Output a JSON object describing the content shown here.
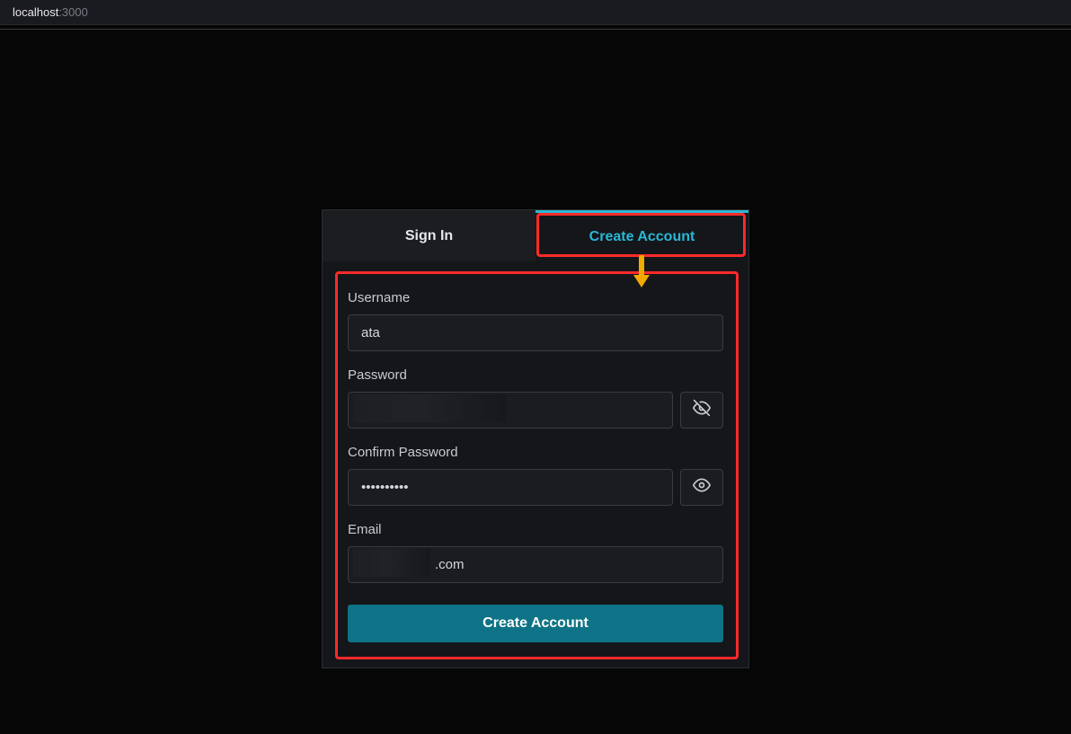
{
  "address": {
    "host": "localhost",
    "port": ":3000"
  },
  "tabs": {
    "signin_label": "Sign In",
    "create_label": "Create Account"
  },
  "form": {
    "username_label": "Username",
    "username_value": "ata",
    "password_label": "Password",
    "password_value": "",
    "confirm_label": "Confirm Password",
    "confirm_value": "••••••••••",
    "email_label": "Email",
    "email_value": ".com",
    "submit_label": "Create Account"
  },
  "icons": {
    "eye_hidden": "eye-off-icon",
    "eye_visible": "eye-icon"
  },
  "colors": {
    "accent": "#2ab7d6",
    "submit_bg": "#0e7386",
    "annotation": "#ff2a2a",
    "arrow": "#f2a900"
  }
}
